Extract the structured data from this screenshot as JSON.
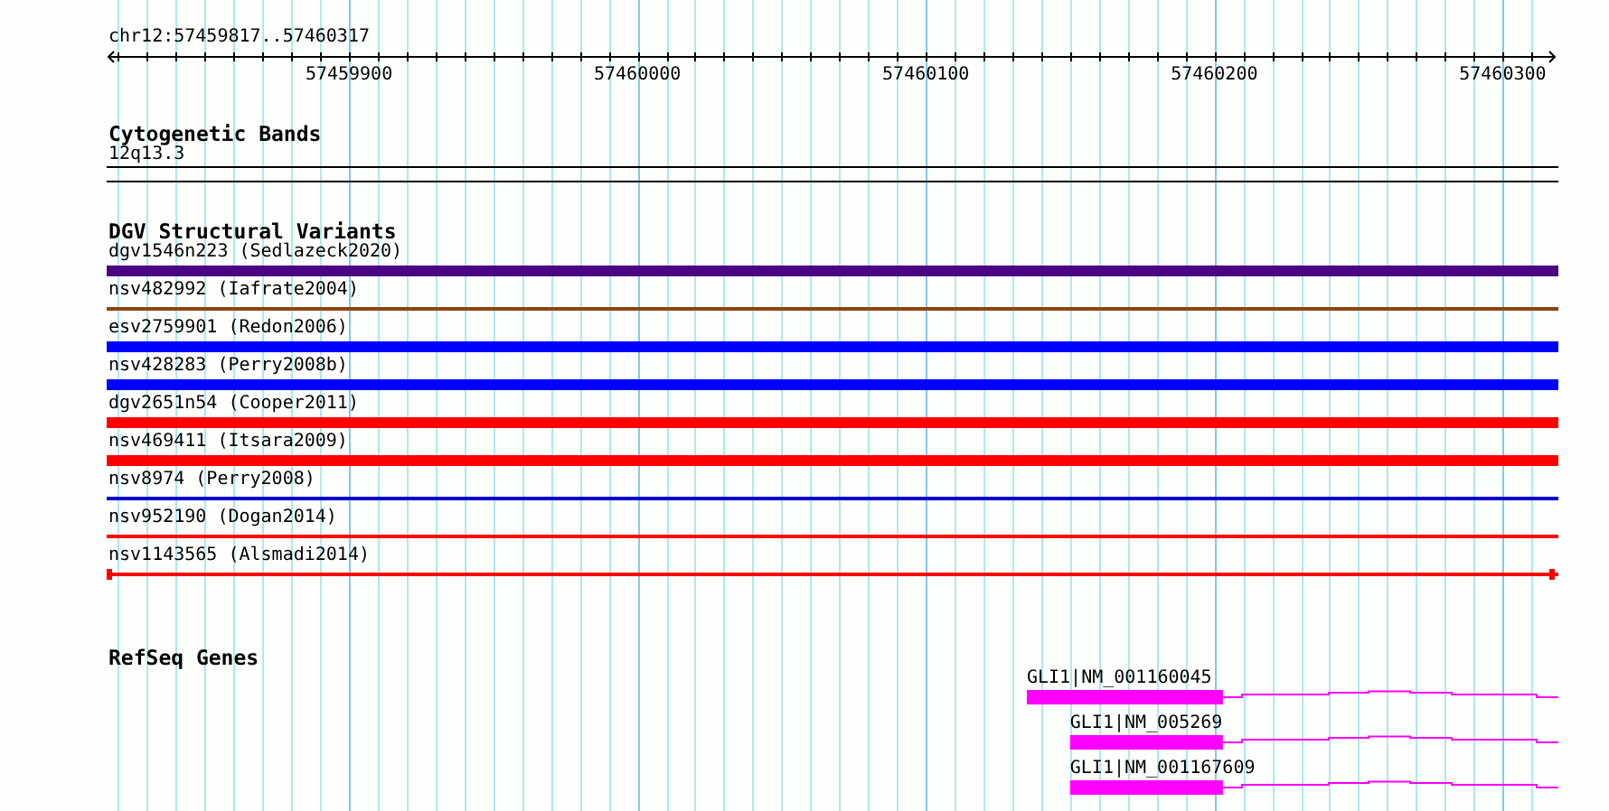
{
  "ruler": {
    "label": "chr12:57459817..57460317",
    "ticks": [
      "57459900",
      "57460000",
      "57460100",
      "57460200",
      "57460300"
    ]
  },
  "cytogenetic_bands": {
    "title": "Cytogenetic Bands",
    "bands": [
      "12q13.3"
    ]
  },
  "dgv_structural_variants": {
    "title": "DGV Structural Variants",
    "rows": [
      {
        "label": "dgv1546n223 (Sedlazeck2020)",
        "color": "#4b0082",
        "kind": "thick"
      },
      {
        "label": "nsv482992 (Iafrate2004)",
        "color": "#8b4513",
        "kind": "thin"
      },
      {
        "label": "esv2759901 (Redon2006)",
        "color": "#0000ff",
        "kind": "thick"
      },
      {
        "label": "nsv428283 (Perry2008b)",
        "color": "#0000ff",
        "kind": "thick"
      },
      {
        "label": "dgv2651n54 (Cooper2011)",
        "color": "#ff0000",
        "kind": "thick"
      },
      {
        "label": "nsv469411 (Itsara2009)",
        "color": "#ff0000",
        "kind": "thick"
      },
      {
        "label": "nsv8974 (Perry2008)",
        "color": "#0000cd",
        "kind": "thin"
      },
      {
        "label": "nsv952190 (Dogan2014)",
        "color": "#ff0000",
        "kind": "thin"
      },
      {
        "label": "nsv1143565 (Alsmadi2014)",
        "color": "#ff0000",
        "kind": "capped"
      }
    ]
  },
  "refseq_genes": {
    "title": "RefSeq Genes",
    "genes": [
      {
        "label": "GLI1|NM_001160045"
      },
      {
        "label": "GLI1|NM_005269"
      },
      {
        "label": "GLI1|NM_001167609"
      }
    ]
  }
}
